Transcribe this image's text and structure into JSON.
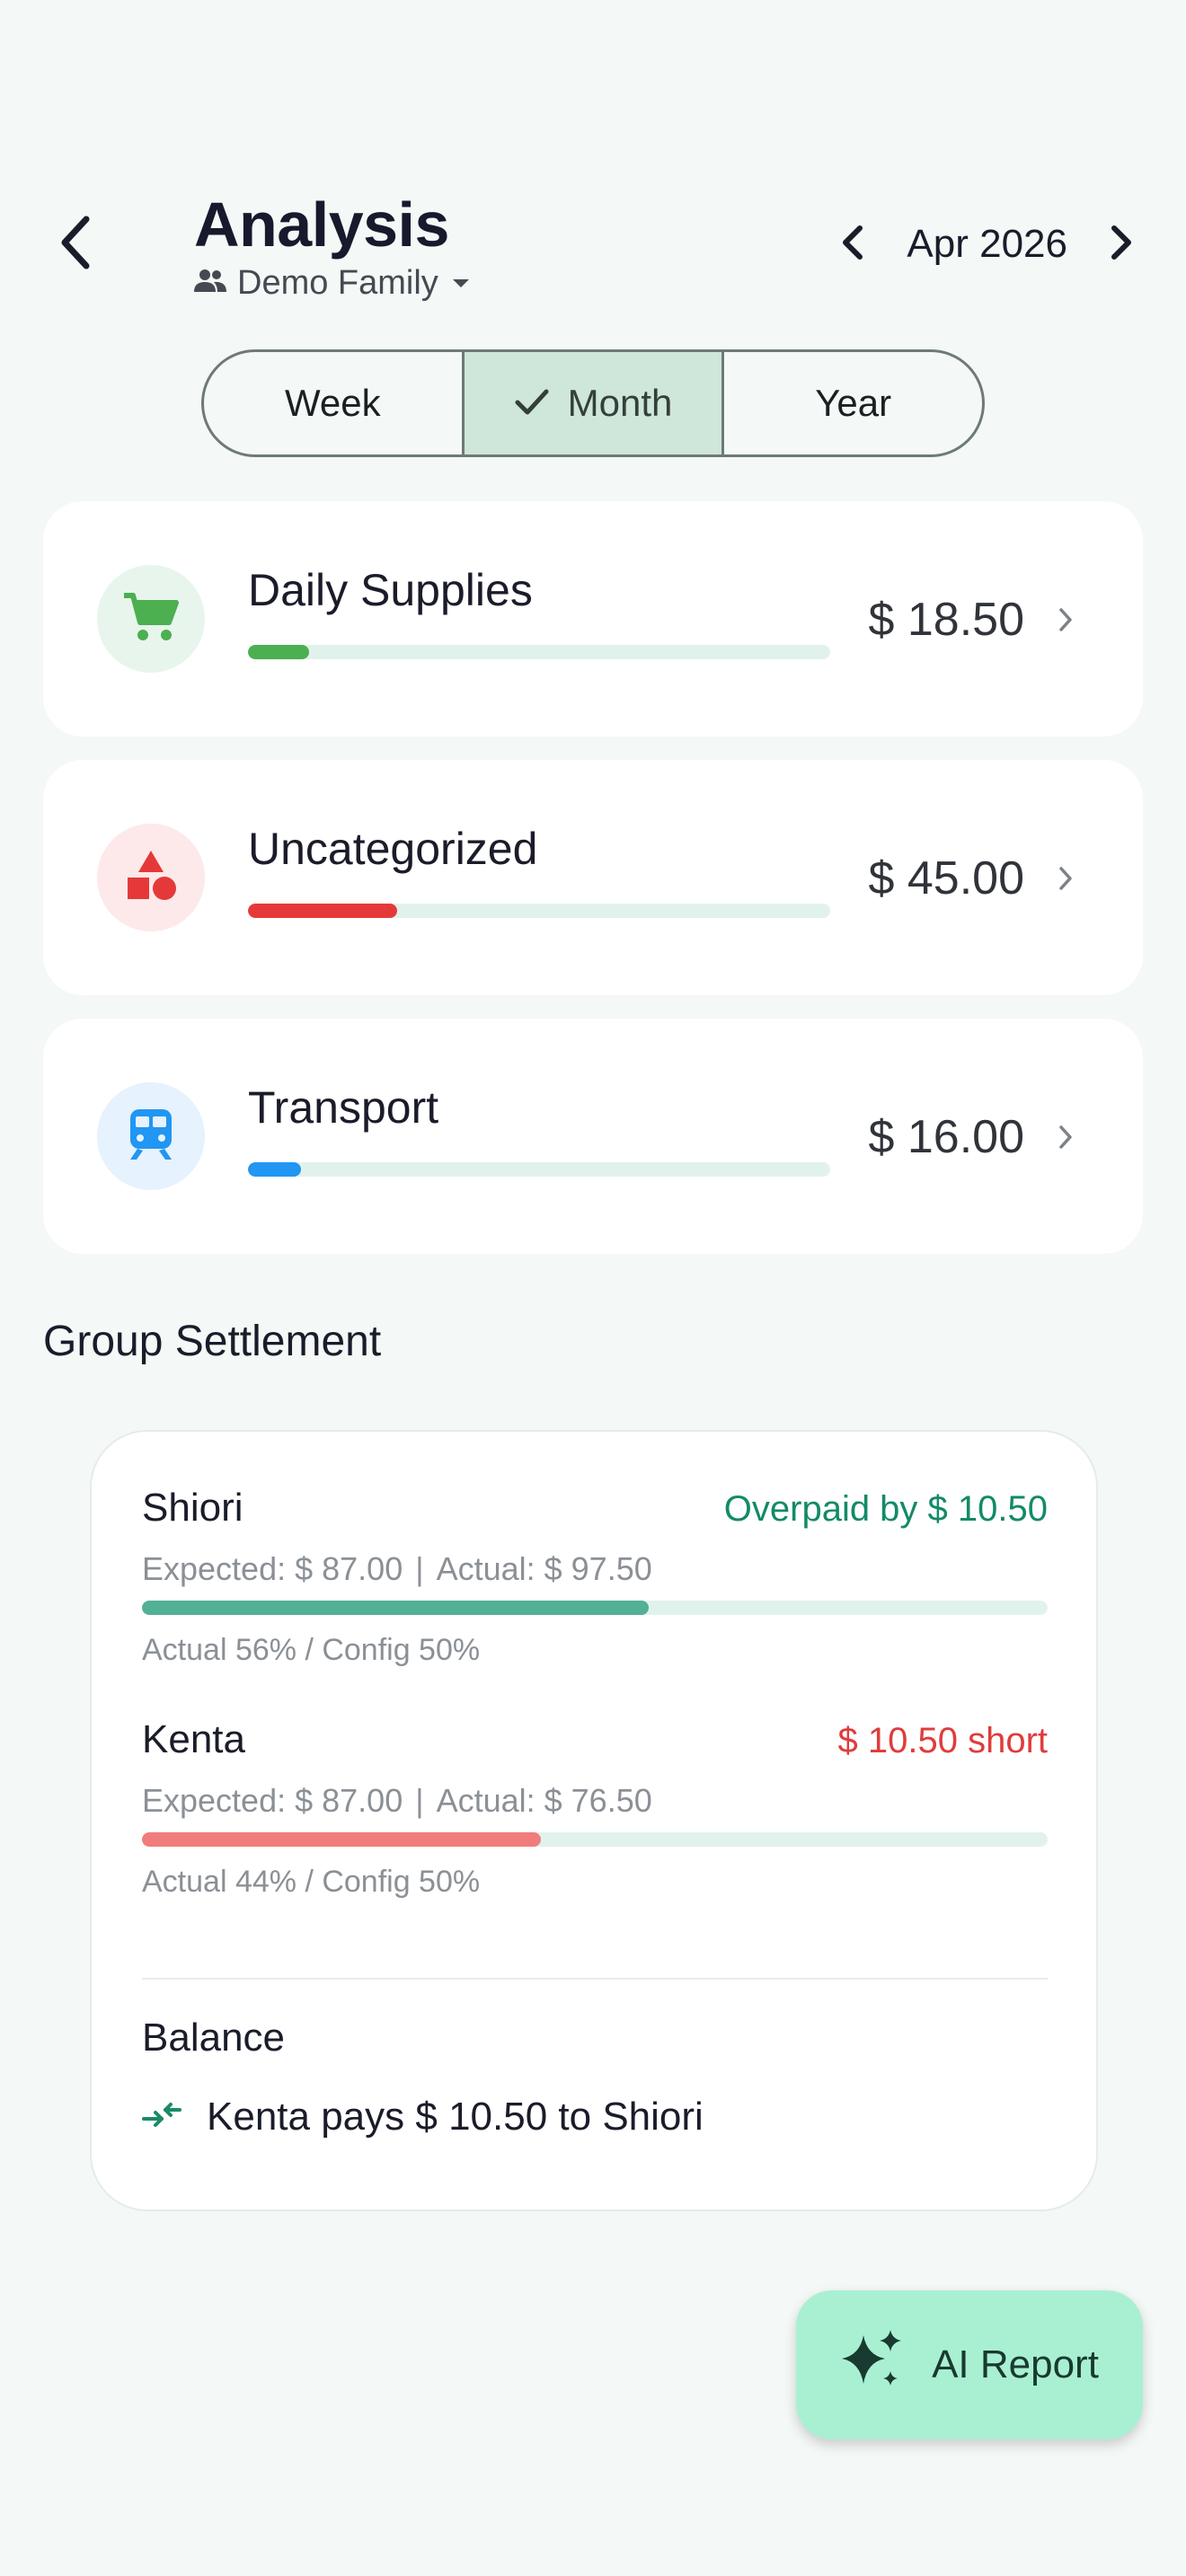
{
  "header": {
    "title": "Analysis",
    "group_name": "Demo Family",
    "month_label": "Apr 2026",
    "icons": {
      "back": "back-arrow-icon",
      "group": "people-icon",
      "prev": "chevron-left-icon",
      "next": "chevron-right-icon"
    }
  },
  "period_tabs": [
    {
      "label": "Week",
      "selected": false
    },
    {
      "label": "Month",
      "selected": true
    },
    {
      "label": "Year",
      "selected": false
    }
  ],
  "categories": [
    {
      "name": "Daily Supplies",
      "amount": "$ 18.50",
      "share": 0.105,
      "icon": "shopping-cart-icon",
      "color": "#4caf50",
      "bg": "#e8f5ec"
    },
    {
      "name": "Uncategorized",
      "amount": "$ 45.00",
      "share": 0.256,
      "icon": "shapes-icon",
      "color": "#e53939",
      "bg": "#fde9ea"
    },
    {
      "name": "Transport",
      "amount": "$ 16.00",
      "share": 0.091,
      "icon": "train-icon",
      "color": "#2196f3",
      "bg": "#e6f2fd"
    }
  ],
  "settlement": {
    "title": "Group Settlement",
    "members": [
      {
        "name": "Shiori",
        "status": "Overpaid by $ 10.50",
        "status_color": "#138a68",
        "expected": "Expected: $ 87.00",
        "separator": "|",
        "actual": "Actual: $ 97.50",
        "ratio_text": "Actual 56% / Config 50%",
        "actual_share": 0.56,
        "bar_color": "#52b096"
      },
      {
        "name": "Kenta",
        "status": "$ 10.50 short",
        "status_color": "#e03c3c",
        "expected": "Expected: $ 87.00",
        "separator": "|",
        "actual": "Actual: $ 76.50",
        "ratio_text": "Actual 44% / Config 50%",
        "actual_share": 0.44,
        "bar_color": "#f07d7b"
      }
    ],
    "balance_title": "Balance",
    "transfer_text": "Kenta pays $ 10.50 to Shiori",
    "transfer_icon": "transfer-arrows-icon"
  },
  "fab": {
    "label": "AI Report",
    "icon": "sparkle-icon"
  }
}
